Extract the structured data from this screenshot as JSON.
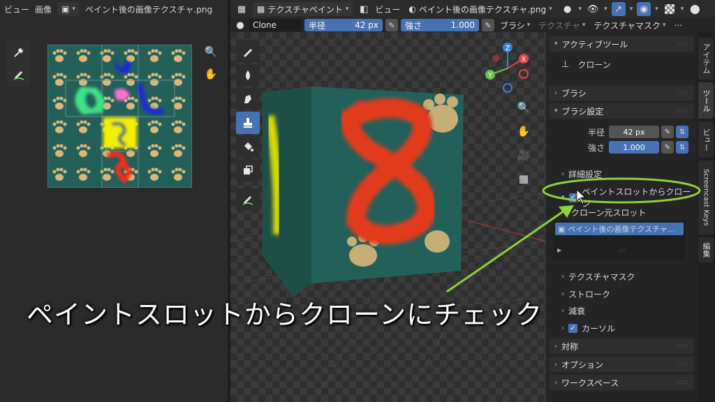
{
  "header_left": {
    "menu_view": "ビュー",
    "menu_image": "画像",
    "image_name": "ペイント後の画像テクスチャ.png"
  },
  "header_right": {
    "mode": "テクスチャペイント",
    "menu_view": "ビュー",
    "image_name": "ペイント後の画像テクスチャ.png"
  },
  "tool_settings": {
    "brush_name": "Clone",
    "radius_label": "半径",
    "radius_value": "42 px",
    "strength_label": "強さ",
    "strength_value": "1.000",
    "brush_menu": "ブラシ",
    "texture_menu": "テクスチャ",
    "texture_mask_menu": "テクスチャマスク"
  },
  "properties": {
    "active_tool_header": "アクティブツール",
    "active_tool_name": "クローン",
    "brush_header": "ブラシ",
    "brush_settings_header": "ブラシ設定",
    "radius_label": "半径",
    "radius_value": "42 px",
    "strength_label": "強さ",
    "strength_value": "1.000",
    "advanced": "詳細設定",
    "clone_from_slot": "ペイントスロットからクローン",
    "clone_source_slot": "クローン元スロット",
    "slot_item": "ペイント後の画像テクスチャ...",
    "texture_mask": "テクスチャマスク",
    "stroke": "ストローク",
    "falloff": "減衰",
    "cursor": "カーソル",
    "symmetry": "対称",
    "options": "オプション",
    "workspace": "ワークスペース"
  },
  "tabs": [
    "アイテム",
    "ツール",
    "ビュー",
    "Screencast Keys",
    "編集"
  ],
  "caption": "ペイントスロットからクローンにチェック",
  "gizmo": {
    "x": "X",
    "y": "Y",
    "z": "Z"
  },
  "colors": {
    "accent_blue": "#4772b3",
    "highlight_green": "#8cd13a",
    "cube_teal": "#24605a",
    "paint_red": "#e23b1f"
  }
}
